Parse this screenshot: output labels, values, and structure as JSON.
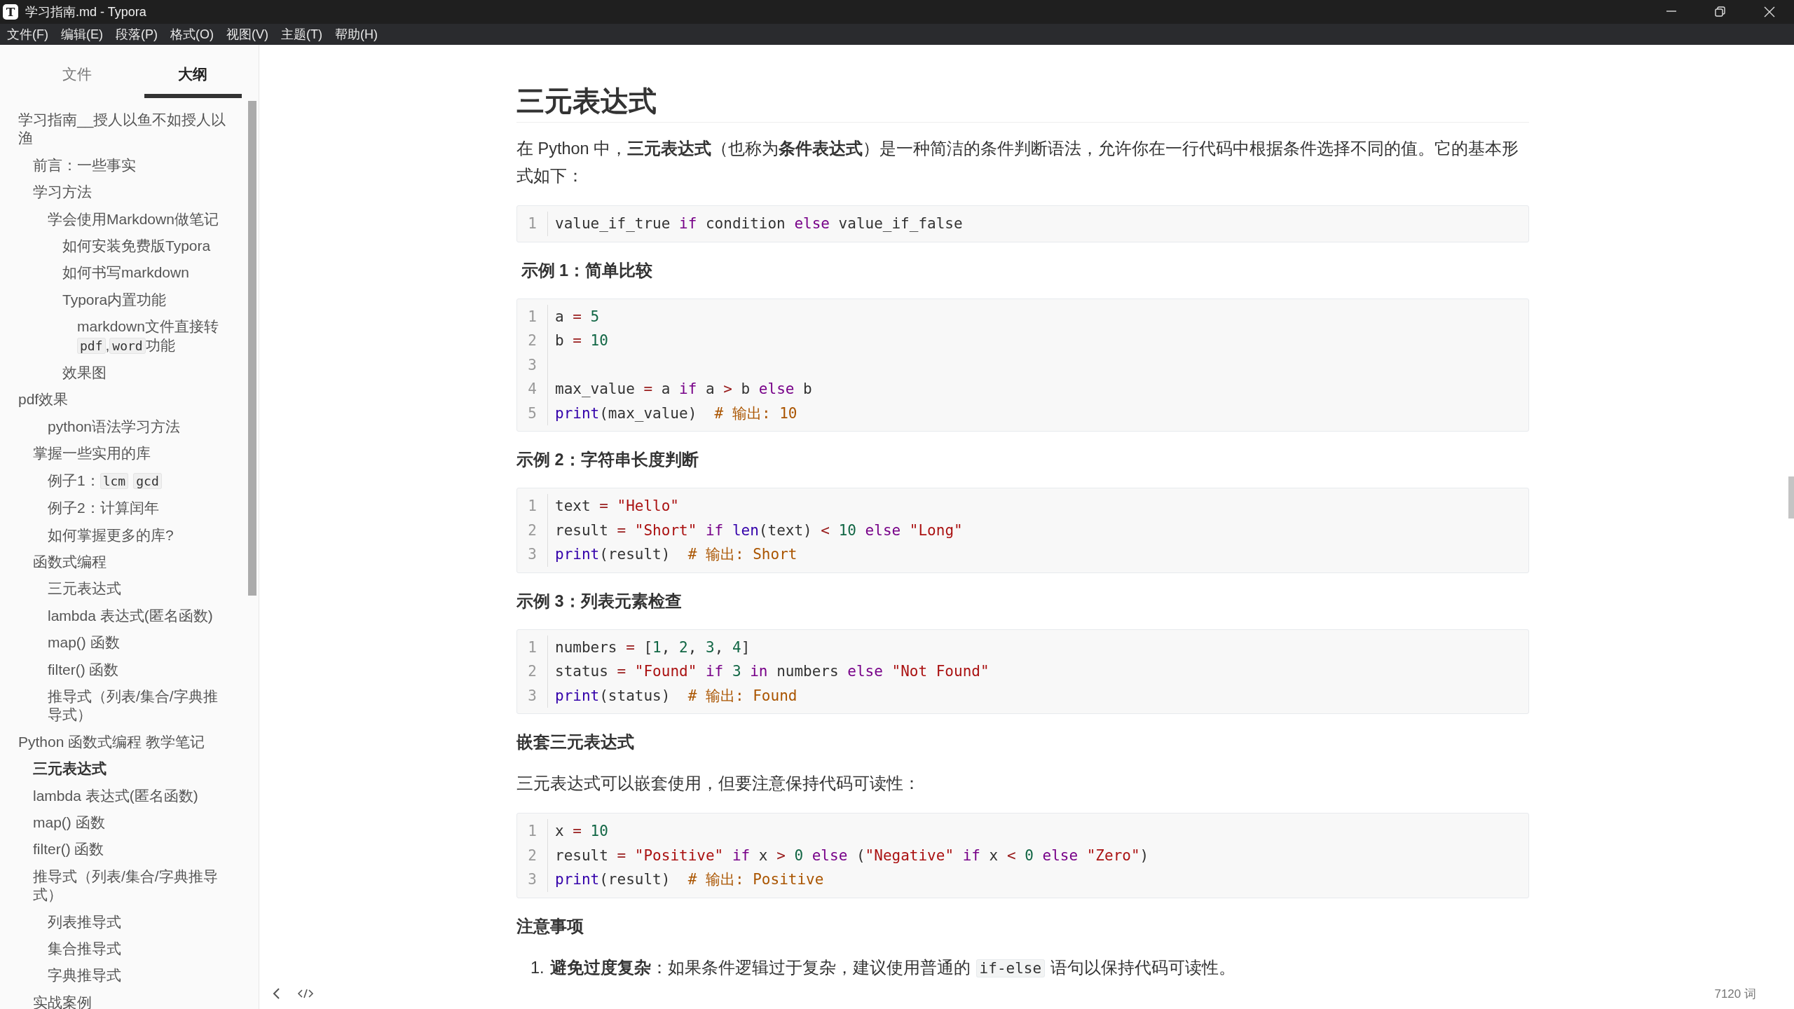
{
  "window": {
    "icon_letter": "T",
    "title": "学习指南.md - Typora",
    "controls": [
      {
        "kind": "minimize"
      },
      {
        "kind": "restore"
      },
      {
        "kind": "close"
      }
    ]
  },
  "menu": [
    "文件(F)",
    "编辑(E)",
    "段落(P)",
    "格式(O)",
    "视图(V)",
    "主题(T)",
    "帮助(H)"
  ],
  "sidebar": {
    "tabs": [
      {
        "label": "文件",
        "selected": false
      },
      {
        "label": "大纲",
        "selected": true
      }
    ],
    "outline": [
      {
        "text": "学习指南__授人以鱼不如授人以渔",
        "selected": false,
        "children": [
          {
            "text": "前言：一些事实",
            "selected": false
          },
          {
            "text": "学习方法",
            "selected": false,
            "children": [
              {
                "text": "学会使用Markdown做笔记",
                "selected": false,
                "children": [
                  {
                    "text": "如何安装免费版Typora",
                    "selected": false
                  },
                  {
                    "text": "如何书写markdown",
                    "selected": false
                  },
                  {
                    "text": "Typora内置功能",
                    "selected": false,
                    "children": [
                      {
                        "segments": [
                          {
                            "kind": "plain",
                            "text": "markdown文件直接转"
                          },
                          {
                            "kind": "code",
                            "text": "pdf"
                          },
                          {
                            "kind": "plain",
                            "text": ","
                          },
                          {
                            "kind": "code",
                            "text": "word"
                          },
                          {
                            "kind": "plain",
                            "text": "功能"
                          }
                        ],
                        "selected": false
                      }
                    ]
                  },
                  {
                    "text": "效果图",
                    "selected": false
                  }
                ]
              }
            ]
          }
        ]
      },
      {
        "text": "pdf效果",
        "selected": false,
        "children": [
          {
            "children": [
              {
                "text": "python语法学习方法",
                "selected": false
              }
            ]
          },
          {
            "text": "掌握一些实用的库",
            "selected": false,
            "children": [
              {
                "segments": [
                  {
                    "kind": "plain",
                    "text": "例子1："
                  },
                  {
                    "kind": "code",
                    "text": "lcm"
                  },
                  {
                    "kind": "code",
                    "text": "gcd"
                  }
                ],
                "selected": false
              },
              {
                "text": "例子2：计算闰年",
                "selected": false
              },
              {
                "text": "如何掌握更多的库?",
                "selected": false
              }
            ]
          },
          {
            "text": "函数式编程",
            "selected": false,
            "children": [
              {
                "text": "三元表达式",
                "selected": false
              },
              {
                "text": "lambda 表达式(匿名函数)",
                "selected": false
              },
              {
                "text": "map() 函数",
                "selected": false
              },
              {
                "text": "filter() 函数",
                "selected": false
              },
              {
                "text": "推导式（列表/集合/字典推导式）",
                "selected": false
              }
            ]
          }
        ]
      },
      {
        "text": "Python 函数式编程 教学笔记",
        "selected": false,
        "children": [
          {
            "text": "三元表达式",
            "selected": true
          },
          {
            "text": "lambda 表达式(匿名函数)",
            "selected": false
          },
          {
            "text": "map() 函数",
            "selected": false
          },
          {
            "text": "filter() 函数",
            "selected": false
          },
          {
            "text": "推导式（列表/集合/字典推导式）",
            "selected": false,
            "children": [
              {
                "text": "列表推导式",
                "selected": false
              },
              {
                "text": "集合推导式",
                "selected": false
              },
              {
                "text": "字典推导式",
                "selected": false
              }
            ]
          },
          {
            "text": "实战案例",
            "selected": false
          }
        ]
      }
    ]
  },
  "document": [
    {
      "kind": "h1",
      "text": "三元表达式"
    },
    {
      "kind": "p",
      "text": "在 Python 中，**三元表达式**（也称为**条件表达式**）是一种简洁的条件判断语法，允许你在一行代码中根据条件选择不同的值。它的基本形式如下："
    },
    {
      "kind": "code",
      "lines": [
        {
          "n": "1",
          "tokens": [
            {
              "kind": "plain",
              "text": "value_if_true "
            },
            {
              "kind": "keyword",
              "text": "if "
            },
            {
              "kind": "plain",
              "text": "condition "
            },
            {
              "kind": "keyword",
              "text": "else "
            },
            {
              "kind": "plain",
              "text": "value_if_false"
            }
          ]
        }
      ]
    },
    {
      "kind": "h",
      "text": " 示例 1：简单比较"
    },
    {
      "kind": "code",
      "lines": [
        {
          "n": "1",
          "tokens": [
            {
              "kind": "plain",
              "text": "a "
            },
            {
              "kind": "operator",
              "text": "= "
            },
            {
              "kind": "number",
              "text": "5"
            }
          ]
        },
        {
          "n": "2",
          "tokens": [
            {
              "kind": "plain",
              "text": "b "
            },
            {
              "kind": "operator",
              "text": "= "
            },
            {
              "kind": "number",
              "text": "10"
            }
          ]
        },
        {
          "n": "3"
        },
        {
          "n": "4",
          "tokens": [
            {
              "kind": "plain",
              "text": "max_value "
            },
            {
              "kind": "operator",
              "text": "= "
            },
            {
              "kind": "plain",
              "text": "a "
            },
            {
              "kind": "keyword",
              "text": "if "
            },
            {
              "kind": "plain",
              "text": "a "
            },
            {
              "kind": "operator",
              "text": "> "
            },
            {
              "kind": "plain",
              "text": "b "
            },
            {
              "kind": "keyword",
              "text": "else "
            },
            {
              "kind": "plain",
              "text": "b"
            }
          ]
        },
        {
          "n": "5",
          "tokens": [
            {
              "kind": "builtin",
              "text": "print"
            },
            {
              "kind": "plain",
              "text": "(max_value)  "
            },
            {
              "kind": "comment",
              "text": "# 输出: 10"
            }
          ]
        }
      ]
    },
    {
      "kind": "h",
      "text": "示例 2：字符串长度判断"
    },
    {
      "kind": "code",
      "lines": [
        {
          "n": "1",
          "tokens": [
            {
              "kind": "plain",
              "text": "text "
            },
            {
              "kind": "operator",
              "text": "= "
            },
            {
              "kind": "string",
              "text": "\"Hello\""
            }
          ]
        },
        {
          "n": "2",
          "tokens": [
            {
              "kind": "plain",
              "text": "result "
            },
            {
              "kind": "operator",
              "text": "= "
            },
            {
              "kind": "string",
              "text": "\"Short\""
            },
            {
              "kind": "keyword",
              "text": " if "
            },
            {
              "kind": "builtin",
              "text": "len"
            },
            {
              "kind": "plain",
              "text": "(text) "
            },
            {
              "kind": "operator",
              "text": "< "
            },
            {
              "kind": "number",
              "text": "10"
            },
            {
              "kind": "keyword",
              "text": " else "
            },
            {
              "kind": "string",
              "text": "\"Long\""
            }
          ]
        },
        {
          "n": "3",
          "tokens": [
            {
              "kind": "builtin",
              "text": "print"
            },
            {
              "kind": "plain",
              "text": "(result)  "
            },
            {
              "kind": "comment",
              "text": "# 输出: Short"
            }
          ]
        }
      ]
    },
    {
      "kind": "h",
      "text": "示例 3：列表元素检查"
    },
    {
      "kind": "code",
      "lines": [
        {
          "n": "1",
          "tokens": [
            {
              "kind": "plain",
              "text": "numbers "
            },
            {
              "kind": "operator",
              "text": "= "
            },
            {
              "kind": "plain",
              "text": "["
            },
            {
              "kind": "number",
              "text": "1"
            },
            {
              "kind": "plain",
              "text": ", "
            },
            {
              "kind": "number",
              "text": "2"
            },
            {
              "kind": "plain",
              "text": ", "
            },
            {
              "kind": "number",
              "text": "3"
            },
            {
              "kind": "plain",
              "text": ", "
            },
            {
              "kind": "number",
              "text": "4"
            },
            {
              "kind": "plain",
              "text": "]"
            }
          ]
        },
        {
          "n": "2",
          "tokens": [
            {
              "kind": "plain",
              "text": "status "
            },
            {
              "kind": "operator",
              "text": "= "
            },
            {
              "kind": "string",
              "text": "\"Found\""
            },
            {
              "kind": "keyword",
              "text": " if "
            },
            {
              "kind": "number",
              "text": "3"
            },
            {
              "kind": "keyword",
              "text": " in "
            },
            {
              "kind": "plain",
              "text": "numbers "
            },
            {
              "kind": "keyword",
              "text": "else "
            },
            {
              "kind": "string",
              "text": "\"Not Found\""
            }
          ]
        },
        {
          "n": "3",
          "tokens": [
            {
              "kind": "builtin",
              "text": "print"
            },
            {
              "kind": "plain",
              "text": "(status)  "
            },
            {
              "kind": "comment",
              "text": "# 输出: Found"
            }
          ]
        }
      ]
    },
    {
      "kind": "h",
      "text": "嵌套三元表达式"
    },
    {
      "kind": "p",
      "text": "三元表达式可以嵌套使用，但要注意保持代码可读性："
    },
    {
      "kind": "code",
      "lines": [
        {
          "n": "1",
          "tokens": [
            {
              "kind": "plain",
              "text": "x "
            },
            {
              "kind": "operator",
              "text": "= "
            },
            {
              "kind": "number",
              "text": "10"
            }
          ]
        },
        {
          "n": "2",
          "tokens": [
            {
              "kind": "plain",
              "text": "result "
            },
            {
              "kind": "operator",
              "text": "= "
            },
            {
              "kind": "string",
              "text": "\"Positive\""
            },
            {
              "kind": "keyword",
              "text": " if "
            },
            {
              "kind": "plain",
              "text": "x "
            },
            {
              "kind": "operator",
              "text": "> "
            },
            {
              "kind": "number",
              "text": "0"
            },
            {
              "kind": "keyword",
              "text": " else "
            },
            {
              "kind": "plain",
              "text": "("
            },
            {
              "kind": "string",
              "text": "\"Negative\""
            },
            {
              "kind": "keyword",
              "text": " if "
            },
            {
              "kind": "plain",
              "text": "x "
            },
            {
              "kind": "operator",
              "text": "< "
            },
            {
              "kind": "number",
              "text": "0"
            },
            {
              "kind": "keyword",
              "text": " else "
            },
            {
              "kind": "string",
              "text": "\"Zero\""
            },
            {
              "kind": "plain",
              "text": ")"
            }
          ]
        },
        {
          "n": "3",
          "tokens": [
            {
              "kind": "builtin",
              "text": "print"
            },
            {
              "kind": "plain",
              "text": "(result)  "
            },
            {
              "kind": "comment",
              "text": "# 输出: Positive"
            }
          ]
        }
      ]
    },
    {
      "kind": "h",
      "text": "注意事项"
    },
    {
      "kind": "ol",
      "items": [
        {
          "n": "1.",
          "segments": [
            {
              "kind": "bold",
              "text": "避免过度复杂"
            },
            {
              "kind": "plain",
              "text": "：如果条件逻辑过于复杂，建议使用普通的"
            },
            {
              "kind": "code",
              "text": "if-else"
            },
            {
              "kind": "plain",
              "text": "语句以保持代码可读性。"
            }
          ]
        }
      ]
    }
  ],
  "footer": {
    "word_count": "7120 词"
  }
}
